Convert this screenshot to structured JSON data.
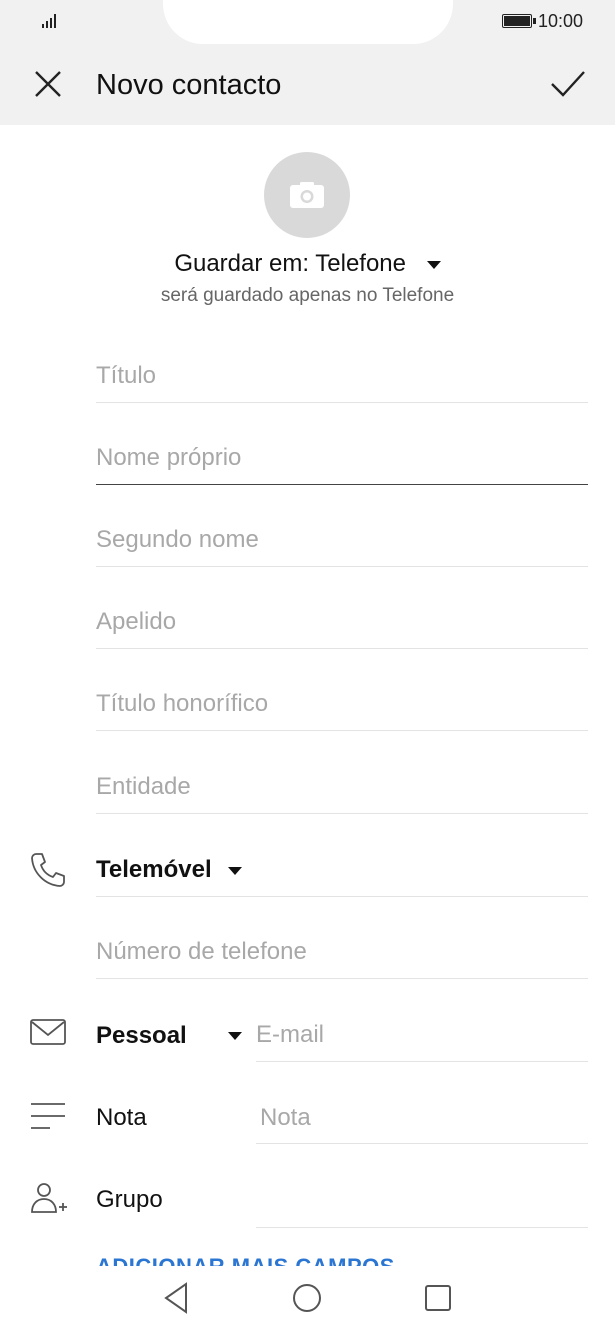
{
  "status": {
    "time": "10:00"
  },
  "header": {
    "title": "Novo contacto"
  },
  "save_location": {
    "label": "Guardar em: Telefone",
    "subtitle": "será guardado apenas no Telefone"
  },
  "fields": {
    "titulo": {
      "placeholder": "Título"
    },
    "nome_proprio": {
      "placeholder": "Nome próprio"
    },
    "segundo_nome": {
      "placeholder": "Segundo nome"
    },
    "apelido": {
      "placeholder": "Apelido"
    },
    "titulo_honorifico": {
      "placeholder": "Título honorífico"
    },
    "entidade": {
      "placeholder": "Entidade"
    }
  },
  "phone": {
    "type_label": "Telemóvel",
    "placeholder": "Número de telefone"
  },
  "email": {
    "type_label": "Pessoal",
    "placeholder": "E-mail"
  },
  "note": {
    "label": "Nota",
    "placeholder": "Nota"
  },
  "group": {
    "label": "Grupo"
  },
  "more_fields": "ADICIONAR MAIS CAMPOS",
  "colors": {
    "accent": "#2a76d2",
    "header_bg": "#f1f1f1",
    "avatar_bg": "#d9d9d9"
  }
}
